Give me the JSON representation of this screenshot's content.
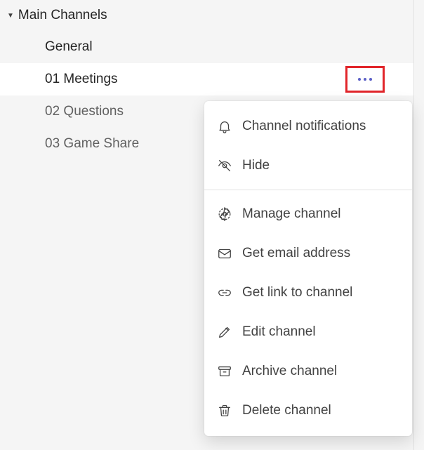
{
  "team": {
    "name": "Main Channels"
  },
  "channels": [
    {
      "label": "General"
    },
    {
      "label": "01 Meetings"
    },
    {
      "label": "02 Questions"
    },
    {
      "label": "03 Game Share"
    }
  ],
  "menu": {
    "notifications": "Channel notifications",
    "hide": "Hide",
    "manage": "Manage channel",
    "email": "Get email address",
    "link": "Get link to channel",
    "edit": "Edit channel",
    "archive": "Archive channel",
    "delete": "Delete channel"
  }
}
